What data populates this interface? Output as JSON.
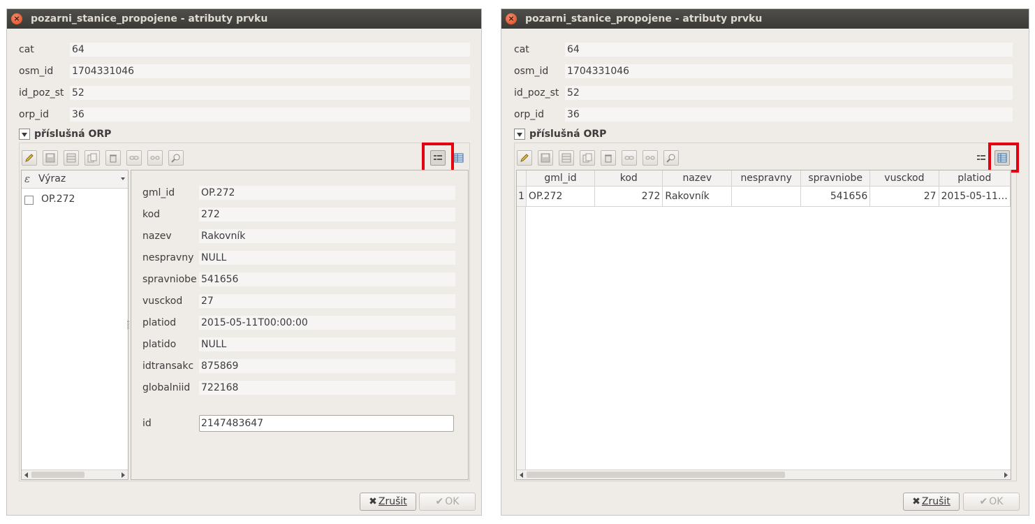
{
  "dialog_title": "pozarni_stanice_propojene - atributy prvku",
  "fields": [
    {
      "label": "cat",
      "value": "64"
    },
    {
      "label": "osm_id",
      "value": "1704331046"
    },
    {
      "label": "id_poz_st",
      "value": "52"
    },
    {
      "label": "orp_id",
      "value": "36"
    }
  ],
  "relation_section": {
    "title": "příslušná ORP"
  },
  "toolbar": {
    "icons": [
      "edit-pencil-icon",
      "save-icon",
      "add-feature-icon",
      "duplicate-icon",
      "delete-icon",
      "link-icon",
      "unlink-icon",
      "zoom-feature-icon"
    ],
    "view_icons": [
      "form-view-icon",
      "table-view-icon"
    ]
  },
  "highlight_color": "#e3000f",
  "left_dialog": {
    "list_header": "Výraz",
    "list_items": [
      {
        "label": "OP.272"
      }
    ],
    "form_fields": [
      {
        "label": "gml_id",
        "value": "OP.272"
      },
      {
        "label": "kod",
        "value": "272"
      },
      {
        "label": "nazev",
        "value": "Rakovník"
      },
      {
        "label": "nespravny",
        "value": "NULL"
      },
      {
        "label": "spravniobe",
        "value": "541656"
      },
      {
        "label": "vusckod",
        "value": "27"
      },
      {
        "label": "platiod",
        "value": "2015-05-11T00:00:00"
      },
      {
        "label": "platido",
        "value": "NULL"
      },
      {
        "label": "idtransakc",
        "value": "875869"
      },
      {
        "label": "globalniid",
        "value": "722168"
      }
    ],
    "id_field": {
      "label": "id",
      "value": "2147483647"
    }
  },
  "right_dialog": {
    "table": {
      "columns": [
        "gml_id",
        "kod",
        "nazev",
        "nespravny",
        "spravniobe",
        "vusckod",
        "platiod"
      ],
      "rows": [
        {
          "num": "1",
          "cells": [
            "OP.272",
            "272",
            "Rakovník",
            "",
            "541656",
            "27",
            "2015-05-11…"
          ]
        }
      ]
    }
  },
  "buttons": {
    "cancel": "Zrušit",
    "ok": "OK",
    "cancel_icon": "✖",
    "ok_icon": "✔"
  }
}
